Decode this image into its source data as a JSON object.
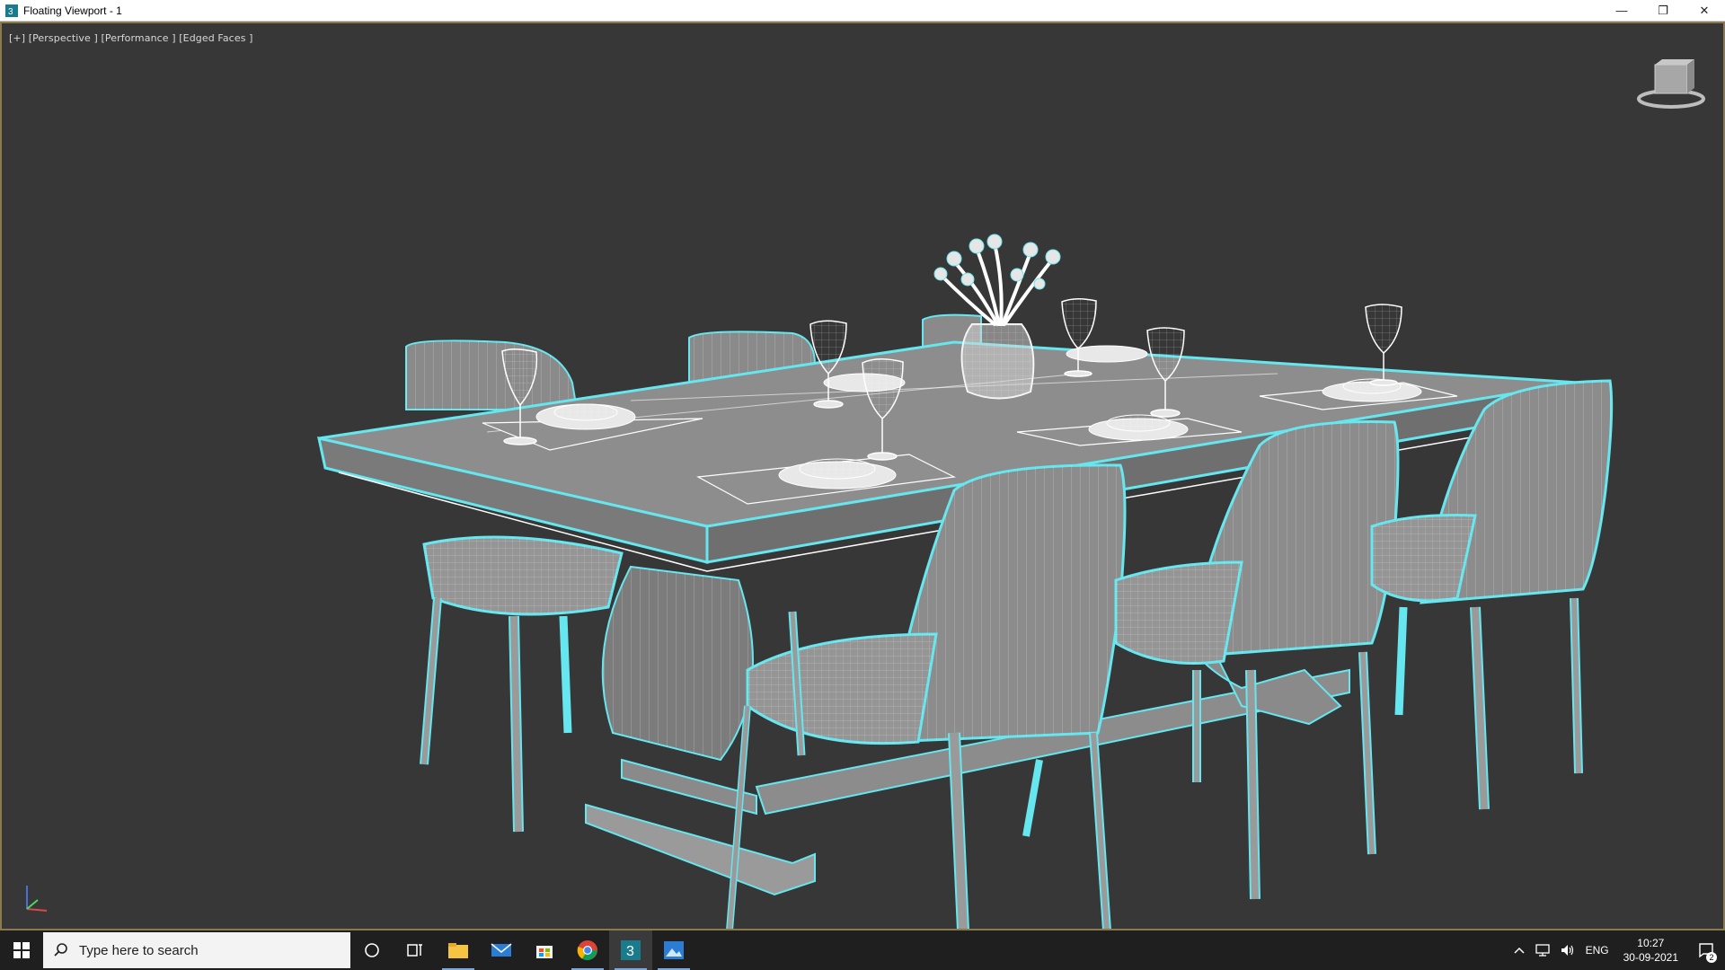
{
  "window": {
    "title": "Floating Viewport - 1",
    "minimize_glyph": "—",
    "restore_glyph": "❐",
    "close_glyph": "✕"
  },
  "viewport": {
    "label": "[+] [Perspective ] [Performance ] [Edged Faces ]",
    "wire_color": "#66e6ee",
    "background_color": "#373737",
    "border_color": "#8a7a4f"
  },
  "taskbar": {
    "search_placeholder": "Type here to search",
    "pinned": [
      {
        "name": "cortana-icon"
      },
      {
        "name": "task-view-icon"
      },
      {
        "name": "file-explorer-icon"
      },
      {
        "name": "mail-icon"
      },
      {
        "name": "microsoft-store-icon"
      },
      {
        "name": "chrome-icon"
      },
      {
        "name": "3ds-max-icon"
      },
      {
        "name": "photos-icon"
      }
    ],
    "tray": {
      "language": "ENG",
      "time": "10:27",
      "date": "30-09-2021",
      "notification_count": "2"
    }
  }
}
